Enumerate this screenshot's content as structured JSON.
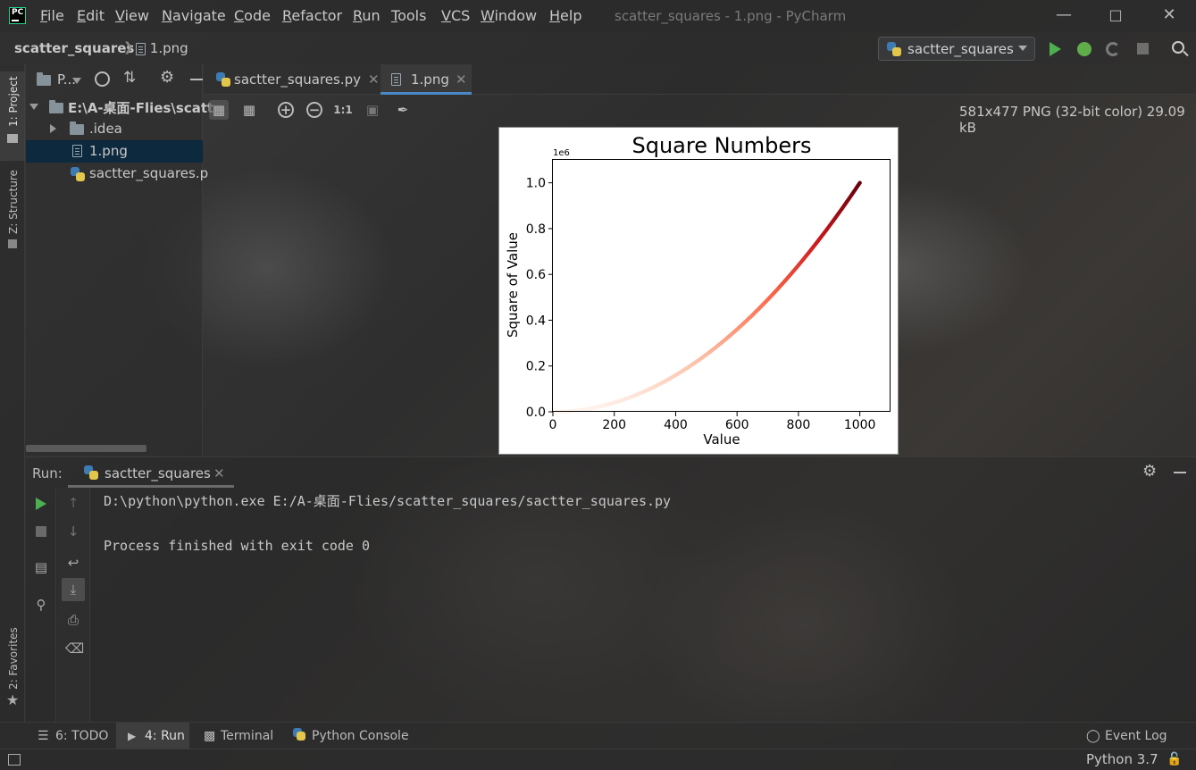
{
  "window": {
    "title": "scatter_squares - 1.png - PyCharm",
    "menu": [
      "File",
      "Edit",
      "View",
      "Navigate",
      "Code",
      "Refactor",
      "Run",
      "Tools",
      "VCS",
      "Window",
      "Help"
    ]
  },
  "navbar": {
    "project": "scatter_squares",
    "file": "1.png",
    "run_config": "sactter_squares"
  },
  "left_strip": {
    "project_tab": "1: Project",
    "structure_tab": "Z: Structure",
    "favorites_tab": "2: Favorites"
  },
  "project_panel": {
    "header": "P...",
    "root": "E:\\A-桌面-Flies\\scatt",
    "items": [
      ".idea",
      "1.png",
      "sactter_squares.p"
    ]
  },
  "editor_tabs": [
    {
      "label": "sactter_squares.py"
    },
    {
      "label": "1.png"
    }
  ],
  "image_viewer": {
    "zoom_actual": "1:1",
    "info": "581x477 PNG (32-bit color) 29.09 kB"
  },
  "run_panel": {
    "title": "Run:",
    "tab": "sactter_squares",
    "console": [
      "D:\\python\\python.exe E:/A-桌面-Flies/scatter_squares/sactter_squares.py",
      "",
      "Process finished with exit code 0"
    ]
  },
  "bottom_tools": {
    "todo": "6: TODO",
    "run": "4: Run",
    "terminal": "Terminal",
    "python_console": "Python Console",
    "event_log": "Event Log"
  },
  "status": {
    "interpreter": "Python 3.7"
  },
  "chart_data": {
    "type": "scatter",
    "title": "Square Numbers",
    "xlabel": "Value",
    "ylabel": "Square of Value",
    "offset_label": "1e6",
    "xlim": [
      0,
      1100
    ],
    "ylim": [
      0,
      1.1
    ],
    "xticks": [
      0,
      200,
      400,
      600,
      800,
      1000
    ],
    "yticks": [
      0.0,
      0.2,
      0.4,
      0.6,
      0.8,
      1.0
    ],
    "ytick_labels": [
      "0.0",
      "0.2",
      "0.4",
      "0.6",
      "0.8",
      "1.0"
    ],
    "series": [
      {
        "x_range": [
          1,
          1000
        ],
        "function": "y = x^2",
        "colormap": "Reds"
      }
    ]
  }
}
